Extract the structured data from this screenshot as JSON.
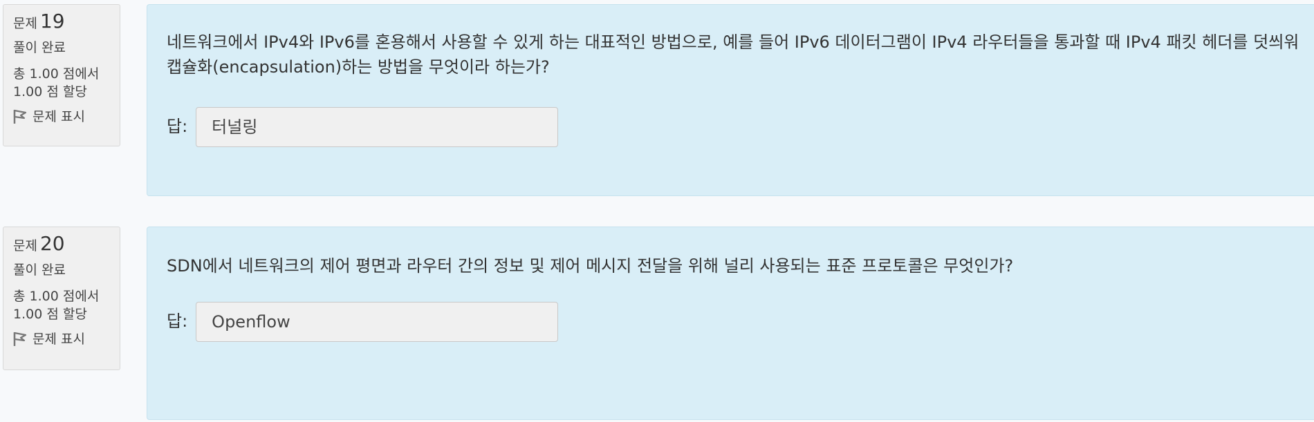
{
  "questions": [
    {
      "label": "문제",
      "number": "19",
      "state": "풀이 완료",
      "grade_line1": "총 1.00 점에서",
      "grade_line2": "1.00 점 할당",
      "flag_label": "문제 표시",
      "text": "네트워크에서 IPv4와 IPv6를 혼용해서 사용할 수 있게 하는 대표적인 방법으로, 예를 들어 IPv6 데이터그램이 IPv4 라우터들을 통과할 때 IPv4 패킷 헤더를 덧씌워 캡슐화(encapsulation)하는 방법을 무엇이라 하는가?",
      "answer_label": "답:",
      "answer_value": "터널링"
    },
    {
      "label": "문제",
      "number": "20",
      "state": "풀이 완료",
      "grade_line1": "총 1.00 점에서",
      "grade_line2": "1.00 점 할당",
      "flag_label": "문제 표시",
      "text": "SDN에서 네트워크의 제어 평면과 라우터 간의 정보 및 제어 메시지 전달을 위해 널리 사용되는 표준 프로토콜은 무엇인가?",
      "answer_label": "답:",
      "answer_value": "Openflow"
    }
  ]
}
